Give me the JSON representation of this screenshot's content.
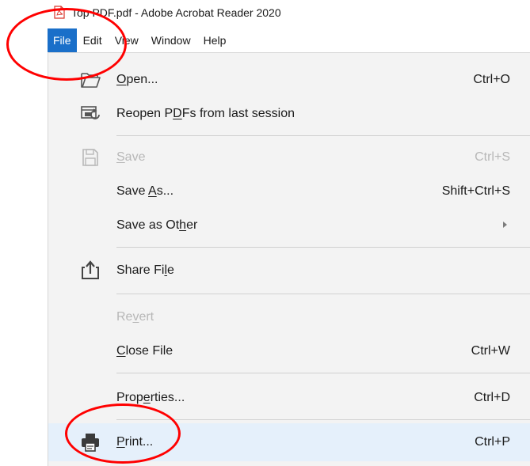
{
  "window": {
    "title": "Top PDF.pdf - Adobe Acrobat Reader 2020",
    "icon": "pdf-file-icon"
  },
  "menubar": {
    "items": [
      "File",
      "Edit",
      "View",
      "Window",
      "Help"
    ],
    "active": "File",
    "active_color": "#1a6fc9"
  },
  "menu": {
    "items": [
      {
        "label_pre": "",
        "label_u": "O",
        "label_post": "pen...",
        "shortcut": "Ctrl+O",
        "icon": "open-folder-icon",
        "enabled": true
      },
      {
        "label_pre": "Reopen P",
        "label_u": "D",
        "label_post": "Fs from last session",
        "shortcut": "",
        "icon": "reopen-icon",
        "enabled": true
      },
      {
        "label_pre": "",
        "label_u": "S",
        "label_post": "ave",
        "shortcut": "Ctrl+S",
        "icon": "save-icon",
        "enabled": false
      },
      {
        "label_pre": "Save ",
        "label_u": "A",
        "label_post": "s...",
        "shortcut": "Shift+Ctrl+S",
        "icon": "",
        "enabled": true
      },
      {
        "label_pre": "Save as Ot",
        "label_u": "h",
        "label_post": "er",
        "shortcut": "",
        "icon": "submenu-arrow-icon",
        "enabled": true
      },
      {
        "label_pre": "Share Fi",
        "label_u": "l",
        "label_post": "e",
        "shortcut": "",
        "icon": "share-icon",
        "enabled": true
      },
      {
        "label_pre": "Re",
        "label_u": "v",
        "label_post": "ert",
        "shortcut": "",
        "icon": "",
        "enabled": false
      },
      {
        "label_pre": "",
        "label_u": "C",
        "label_post": "lose File",
        "shortcut": "Ctrl+W",
        "icon": "",
        "enabled": true
      },
      {
        "label_pre": "Prop",
        "label_u": "e",
        "label_post": "rties...",
        "shortcut": "Ctrl+D",
        "icon": "",
        "enabled": true
      },
      {
        "label_pre": "",
        "label_u": "P",
        "label_post": "rint...",
        "shortcut": "Ctrl+P",
        "icon": "printer-icon",
        "enabled": true,
        "highlighted": true
      }
    ]
  },
  "annotations": {
    "color": "#ff0000",
    "marks": [
      "file-menu-circle",
      "print-item-circle"
    ]
  }
}
